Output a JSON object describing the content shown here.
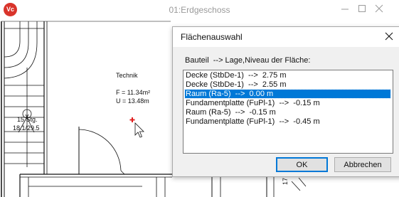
{
  "window": {
    "title": "01:Erdgeschoss",
    "logo_text": "Vc",
    "controls": [
      "minimize",
      "maximize",
      "close"
    ]
  },
  "drawing": {
    "room_name": "Technik",
    "area": "F = 11.34m²",
    "perimeter": "U = 13.48m",
    "stair_count": "15 Stg.",
    "stair_dim": "18.1/29.5",
    "dim_fragment": "17"
  },
  "dialog": {
    "title": "Flächenauswahl",
    "header": "Bauteil  --> Lage,Niveau der Fläche:",
    "items": [
      {
        "label": "Decke (StbDe-1)  -->  2.75 m",
        "selected": false
      },
      {
        "label": "Decke (StbDe-1)  -->  2.55 m",
        "selected": false
      },
      {
        "label": "Raum (Ra-5)  -->  0.00 m",
        "selected": true
      },
      {
        "label": "Fundamentplatte (FuPl-1)  -->  -0.15 m",
        "selected": false
      },
      {
        "label": "Raum (Ra-5)  -->  -0.15 m",
        "selected": false
      },
      {
        "label": "Fundamentplatte (FuPl-1)  -->  -0.45 m",
        "selected": false
      }
    ],
    "ok_label": "OK",
    "cancel_label": "Abbrechen"
  },
  "colors": {
    "selection": "#0078d7",
    "app_logo": "#d9342b",
    "marker": "#e02020"
  }
}
